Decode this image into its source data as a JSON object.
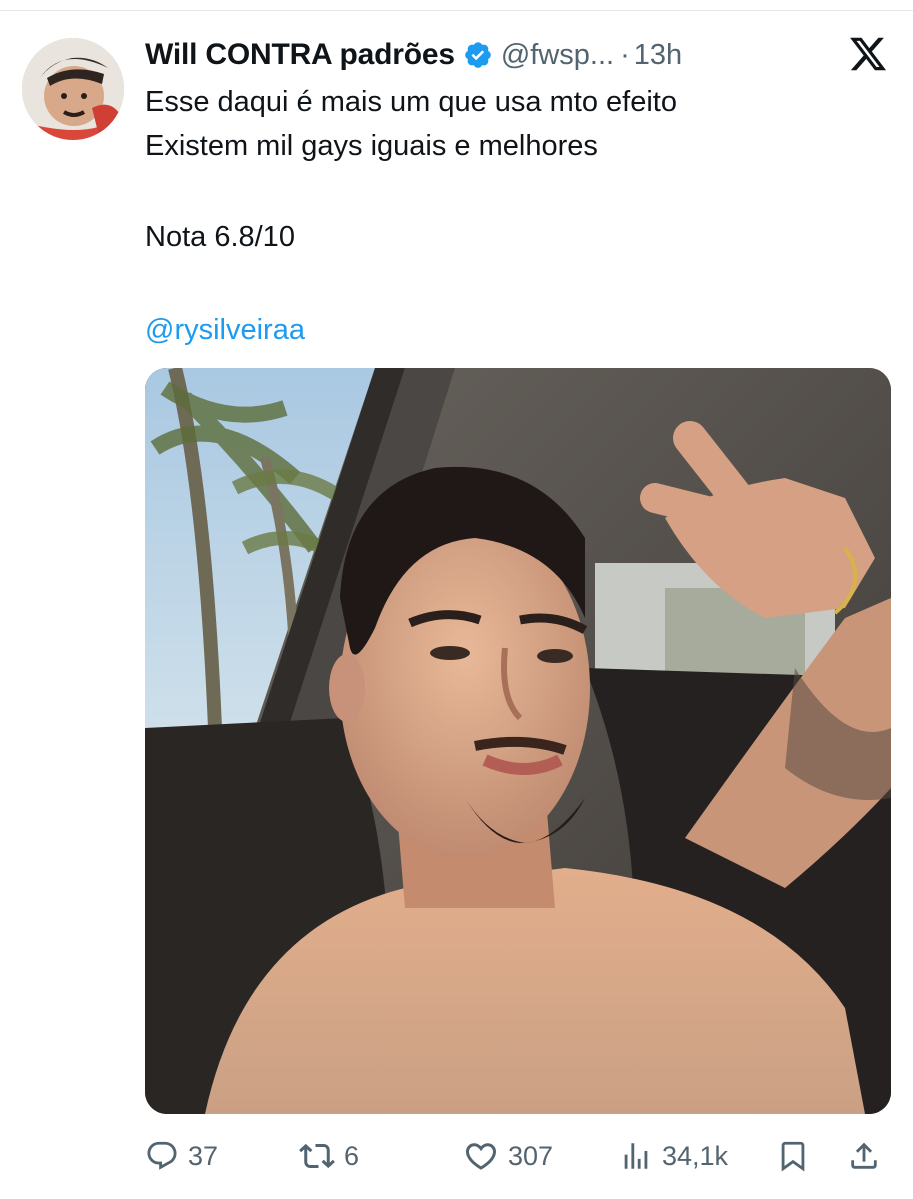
{
  "tweet": {
    "author": {
      "display_name": "Will CONTRA padrões",
      "handle": "@fwsp...",
      "separator": "·",
      "time": "13h",
      "verified": true
    },
    "lines": [
      "Esse daqui é mais um que usa mto efeito",
      "Existem mil gays iguais e melhores",
      "Nota 6.8/10"
    ],
    "mention": "@rysilveiraa",
    "media_icon": "photo-selfie",
    "platform_icon": "x-logo-icon"
  },
  "actions": {
    "reply": {
      "icon": "reply-icon",
      "count": "37"
    },
    "retweet": {
      "icon": "retweet-icon",
      "count": "6"
    },
    "like": {
      "icon": "heart-icon",
      "count": "307"
    },
    "views": {
      "icon": "views-icon",
      "count": "34,1k"
    },
    "bookmark": {
      "icon": "bookmark-icon"
    },
    "share": {
      "icon": "share-icon"
    }
  },
  "colors": {
    "text": "#0f1419",
    "secondary": "#536471",
    "link": "#1d9bf0",
    "verified": "#1d9bf0",
    "divider": "#e6e9eb"
  }
}
